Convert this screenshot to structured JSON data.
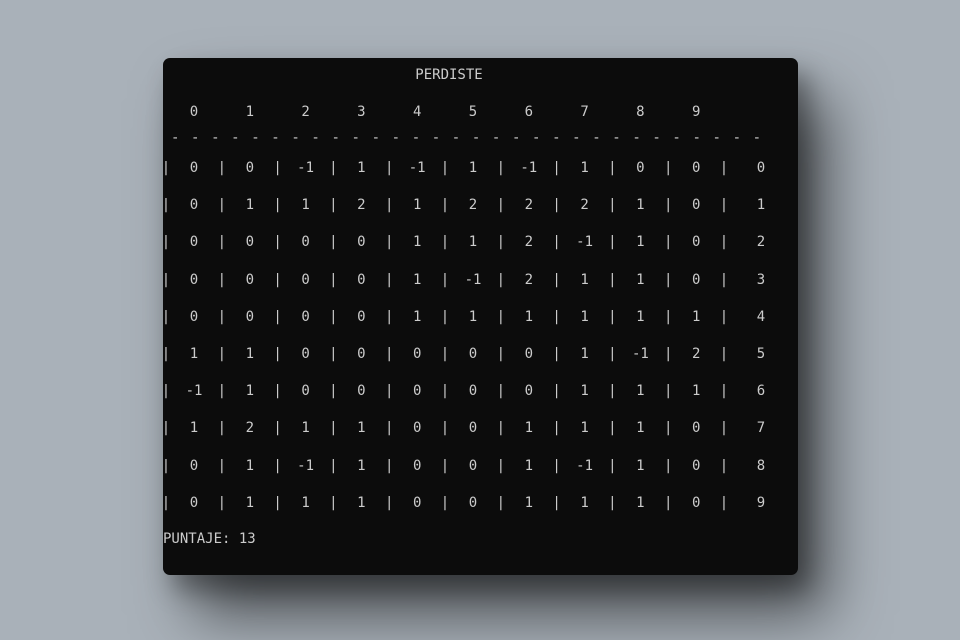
{
  "title": "PERDISTE",
  "column_headers": [
    "0",
    "1",
    "2",
    "3",
    "4",
    "5",
    "6",
    "7",
    "8",
    "9"
  ],
  "separator": "- - - - - - - - - - - - - - - - - - - - - - - - - - - - - -",
  "cell_divider": "|",
  "rows": [
    {
      "label": "0",
      "cells": [
        "0",
        "0",
        "-1",
        "1",
        "-1",
        "1",
        "-1",
        "1",
        "0",
        "0"
      ]
    },
    {
      "label": "1",
      "cells": [
        "0",
        "1",
        "1",
        "2",
        "1",
        "2",
        "2",
        "2",
        "1",
        "0"
      ]
    },
    {
      "label": "2",
      "cells": [
        "0",
        "0",
        "0",
        "0",
        "1",
        "1",
        "2",
        "-1",
        "1",
        "0"
      ]
    },
    {
      "label": "3",
      "cells": [
        "0",
        "0",
        "0",
        "0",
        "1",
        "-1",
        "2",
        "1",
        "1",
        "0"
      ]
    },
    {
      "label": "4",
      "cells": [
        "0",
        "0",
        "0",
        "0",
        "1",
        "1",
        "1",
        "1",
        "1",
        "1"
      ]
    },
    {
      "label": "5",
      "cells": [
        "1",
        "1",
        "0",
        "0",
        "0",
        "0",
        "0",
        "1",
        "-1",
        "2"
      ]
    },
    {
      "label": "6",
      "cells": [
        "-1",
        "1",
        "0",
        "0",
        "0",
        "0",
        "0",
        "1",
        "1",
        "1"
      ]
    },
    {
      "label": "7",
      "cells": [
        "1",
        "2",
        "1",
        "1",
        "0",
        "0",
        "1",
        "1",
        "1",
        "0"
      ]
    },
    {
      "label": "8",
      "cells": [
        "0",
        "1",
        "-1",
        "1",
        "0",
        "0",
        "1",
        "-1",
        "1",
        "0"
      ]
    },
    {
      "label": "9",
      "cells": [
        "0",
        "1",
        "1",
        "1",
        "0",
        "0",
        "1",
        "1",
        "1",
        "0"
      ]
    }
  ],
  "score": "PUNTAJE: 13"
}
